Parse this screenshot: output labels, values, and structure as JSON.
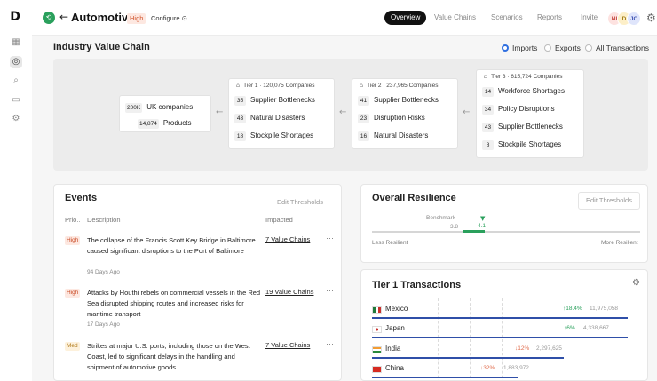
{
  "rail": {
    "logo": "D",
    "icons": [
      "grid-icon",
      "compass-icon",
      "search-icon",
      "folder-icon",
      "gear-icon"
    ]
  },
  "header": {
    "title": "Automotive",
    "priority": "High",
    "configure": "Configure",
    "tabs": [
      "Overview",
      "Value Chains",
      "Scenarios",
      "Reports",
      "Invite"
    ],
    "active_tab": "Overview",
    "avatars": [
      {
        "initials": "NI",
        "bg": "#fde2e0",
        "fg": "#c2413a"
      },
      {
        "initials": "D",
        "bg": "#fdefc8",
        "fg": "#a07a12"
      },
      {
        "initials": "JC",
        "bg": "#dfe5fb",
        "fg": "#3a4fb0"
      }
    ]
  },
  "section": {
    "title": "Industry Value Chain",
    "filters": [
      "Imports",
      "Exports",
      "All Transactions"
    ],
    "selected_filter": "Imports"
  },
  "value_chain": {
    "origin": {
      "uk_count": "200K",
      "uk_label": "UK companies",
      "products_count": "14,874",
      "products_label": "Products"
    },
    "tiers": [
      {
        "header": "Tier 1 · 120,075 Companies",
        "items": [
          {
            "n": "35",
            "label": "Supplier Bottlenecks"
          },
          {
            "n": "43",
            "label": "Natural Disasters"
          },
          {
            "n": "18",
            "label": "Stockpile Shortages"
          }
        ]
      },
      {
        "header": "Tier 2 · 237,965 Companies",
        "items": [
          {
            "n": "41",
            "label": "Supplier Bottlenecks"
          },
          {
            "n": "23",
            "label": "Disruption Risks"
          },
          {
            "n": "16",
            "label": "Natural Disasters"
          }
        ]
      },
      {
        "header": "Tier 3 · 615,724 Companies",
        "items": [
          {
            "n": "14",
            "label": "Workforce Shortages"
          },
          {
            "n": "34",
            "label": "Policy Disruptions"
          },
          {
            "n": "43",
            "label": "Supplier Bottlenecks"
          },
          {
            "n": "8",
            "label": "Stockpile Shortages"
          }
        ]
      }
    ]
  },
  "events": {
    "title": "Events",
    "edit": "Edit Thresholds",
    "columns": {
      "priority": "Prio..",
      "description": "Description",
      "impacted": "Impacted"
    },
    "items": [
      {
        "priority": "High",
        "description": "The collapse of the Francis Scott Key Bridge in Baltimore caused significant disruptions to the Port of Baltimore",
        "ago": "94 Days Ago",
        "impacted": "7 Value Chains"
      },
      {
        "priority": "High",
        "description": "Attacks by Houthi rebels on commercial vessels in the Red Sea disrupted shipping routes and increased risks for maritime transport",
        "ago": "17 Days Ago",
        "impacted": "19 Value Chains"
      },
      {
        "priority": "Med",
        "description": "Strikes at major U.S. ports, including those on the West Coast, led to significant delays in the handling and shipment of automotive goods.",
        "ago": "",
        "impacted": "7 Value Chains"
      }
    ]
  },
  "resilience": {
    "title": "Overall Resilience",
    "edit": "Edit Thresholds",
    "benchmark_label": "Benchmark",
    "benchmark_value": "3.8",
    "current_value": "4.1",
    "low_label": "Less Resilient",
    "high_label": "More Resilient"
  },
  "transactions": {
    "title": "Tier 1 Transactions",
    "rows": [
      {
        "country": "Mexico",
        "change": "↑18.4%",
        "direction": "up",
        "amount": "11,975,058",
        "share": 0.96
      },
      {
        "country": "Japan",
        "change": "↑6%",
        "direction": "up",
        "amount": "4,338,667",
        "share": 0.96
      },
      {
        "country": "India",
        "change": "↓12%",
        "direction": "down",
        "amount": "2,297,625",
        "share": 0.72
      },
      {
        "country": "China",
        "change": "↓32%",
        "direction": "down",
        "amount": "1,883,972",
        "share": 0.55
      }
    ]
  }
}
